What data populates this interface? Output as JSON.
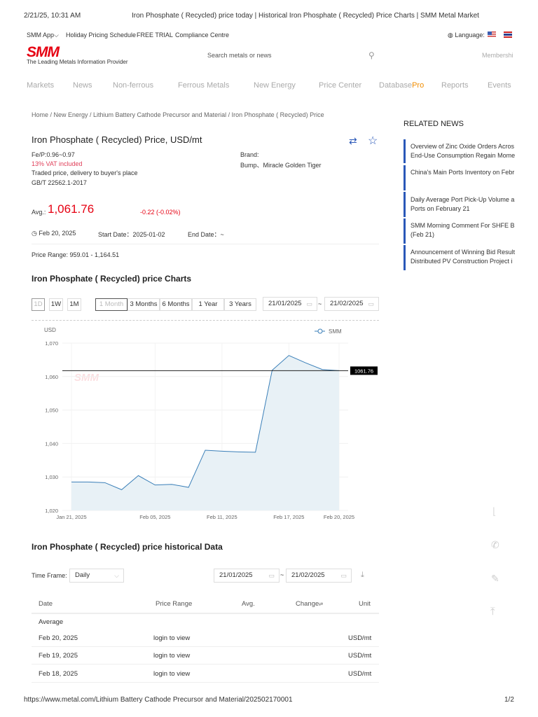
{
  "print_header": {
    "datetime": "2/21/25, 10:31 AM",
    "title": "Iron Phosphate ( Recycled) price today | Historical Iron Phosphate ( Recycled) Price Charts | SMM Metal Market"
  },
  "print_footer": {
    "url": "https://www.metal.com/Lithium Battery Cathode Precursor and Material/202502170001",
    "page": "1/2"
  },
  "topbar": {
    "links": [
      "SMM App",
      "Holiday Pricing Schedule",
      "FREE TRIAL",
      "Compliance Centre"
    ],
    "language_label": "Language:"
  },
  "logo": {
    "text": "SMM",
    "tagline": "The Leading Metals Information Provider"
  },
  "search": {
    "placeholder": "Search metals or news"
  },
  "membership": "Membershi",
  "nav": {
    "items": [
      "Markets",
      "News",
      "Non-ferrous",
      "Ferrous Metals",
      "New Energy",
      "Price Center",
      "Database",
      "Reports",
      "Events"
    ],
    "pro": "Pro"
  },
  "breadcrumb": "Home / New Energy / Lithium Battery Cathode Precursor and Material / Iron Phosphate ( Recycled) Price",
  "product": {
    "title": "Iron Phosphate ( Recycled) Price, USD/mt",
    "spec": "Fe/P:0.96~0.97",
    "vat": "13% VAT included",
    "trade": "Traded price, delivery to buyer's place",
    "standard": "GB/T 22562.1-2017",
    "brand_label": "Brand:",
    "brand": "Bump、Miracle Golden Tiger",
    "avg_label": "Avg.:",
    "avg": "1,061.76",
    "change": "-0.22 (-0.02%)",
    "date": "Feb 20, 2025",
    "start_date": "Start Date：2025-01-02",
    "end_date": "End Date：~",
    "price_range": "Price Range: 959.01 - 1,164.51"
  },
  "charts_section": {
    "title": "Iron Phosphate ( Recycled) price Charts",
    "intervals": [
      "1D",
      "1W",
      "1M"
    ],
    "ranges": [
      "1 Month",
      "3 Months",
      "6 Months",
      "1 Year",
      "3 Years"
    ],
    "from": "21/01/2025",
    "to": "21/02/2025",
    "sep": "~"
  },
  "colors": {
    "brand": "#e60012",
    "line": "#3a7fb8",
    "fill": "#e8f1f6",
    "down": "#e60012",
    "news_bar": "#2a58b8"
  },
  "chart_data": {
    "type": "area",
    "ylabel": "USD",
    "ylim": [
      1020,
      1070
    ],
    "yticks": [
      1020,
      1030,
      1040,
      1050,
      1060,
      1070
    ],
    "ytick_labels": [
      "1,020",
      "1,030",
      "1,040",
      "1,050",
      "1,060",
      "1,070"
    ],
    "x": [
      "Jan 21, 2025",
      "Jan 22, 2025",
      "Jan 23, 2025",
      "Jan 24, 2025",
      "Jan 27, 2025",
      "Feb 05, 2025",
      "Feb 06, 2025",
      "Feb 07, 2025",
      "Feb 10, 2025",
      "Feb 11, 2025",
      "Feb 12, 2025",
      "Feb 13, 2025",
      "Feb 14, 2025",
      "Feb 17, 2025",
      "Feb 18, 2025",
      "Feb 19, 2025",
      "Feb 20, 2025"
    ],
    "xtick_labels": [
      "Jan 21, 2025",
      "Feb 05, 2025",
      "Feb 11, 2025",
      "Feb 17, 2025",
      "Feb 20, 2025"
    ],
    "series": [
      {
        "name": "SMM",
        "values": [
          1028.5,
          1028.5,
          1028.3,
          1026.2,
          1030.4,
          1027.6,
          1027.8,
          1026.9,
          1038.0,
          1037.7,
          1037.5,
          1037.4,
          1061.9,
          1066.3,
          1064.1,
          1062.1,
          1061.76
        ]
      }
    ],
    "reference_line": {
      "value": 1061.76,
      "label": "1061.76"
    },
    "legend": "top-right",
    "grid": true
  },
  "historical": {
    "title": "Iron Phosphate ( Recycled) price historical Data",
    "timeframe_label": "Time Frame:",
    "timeframe": "Daily",
    "from": "21/01/2025",
    "to": "21/02/2025",
    "sep": "~",
    "columns": [
      "Date",
      "Price Range",
      "Avg.",
      "Change",
      "Unit"
    ],
    "average_label": "Average",
    "rows": [
      {
        "date": "Feb 20, 2025",
        "range": "login to view",
        "unit": "USD/mt"
      },
      {
        "date": "Feb 19, 2025",
        "range": "login to view",
        "unit": "USD/mt"
      },
      {
        "date": "Feb 18, 2025",
        "range": "login to view",
        "unit": "USD/mt"
      }
    ]
  },
  "related_news": {
    "title": "RELATED NEWS",
    "items": [
      {
        "l1": "Overview of Zinc Oxide Orders Acros",
        "l2": "End-Use Consumption Regain Mome"
      },
      {
        "l1": "China's Main Ports Inventory on Febr",
        "l2": ""
      },
      {
        "l1": "Daily Average Port Pick-Up Volume a",
        "l2": "Ports on February 21"
      },
      {
        "l1": "SMM Morning Comment For SHFE B",
        "l2": "(Feb 21)"
      },
      {
        "l1": "Announcement of Winning Bid Result",
        "l2": "Distributed PV Construction Project i"
      }
    ]
  }
}
